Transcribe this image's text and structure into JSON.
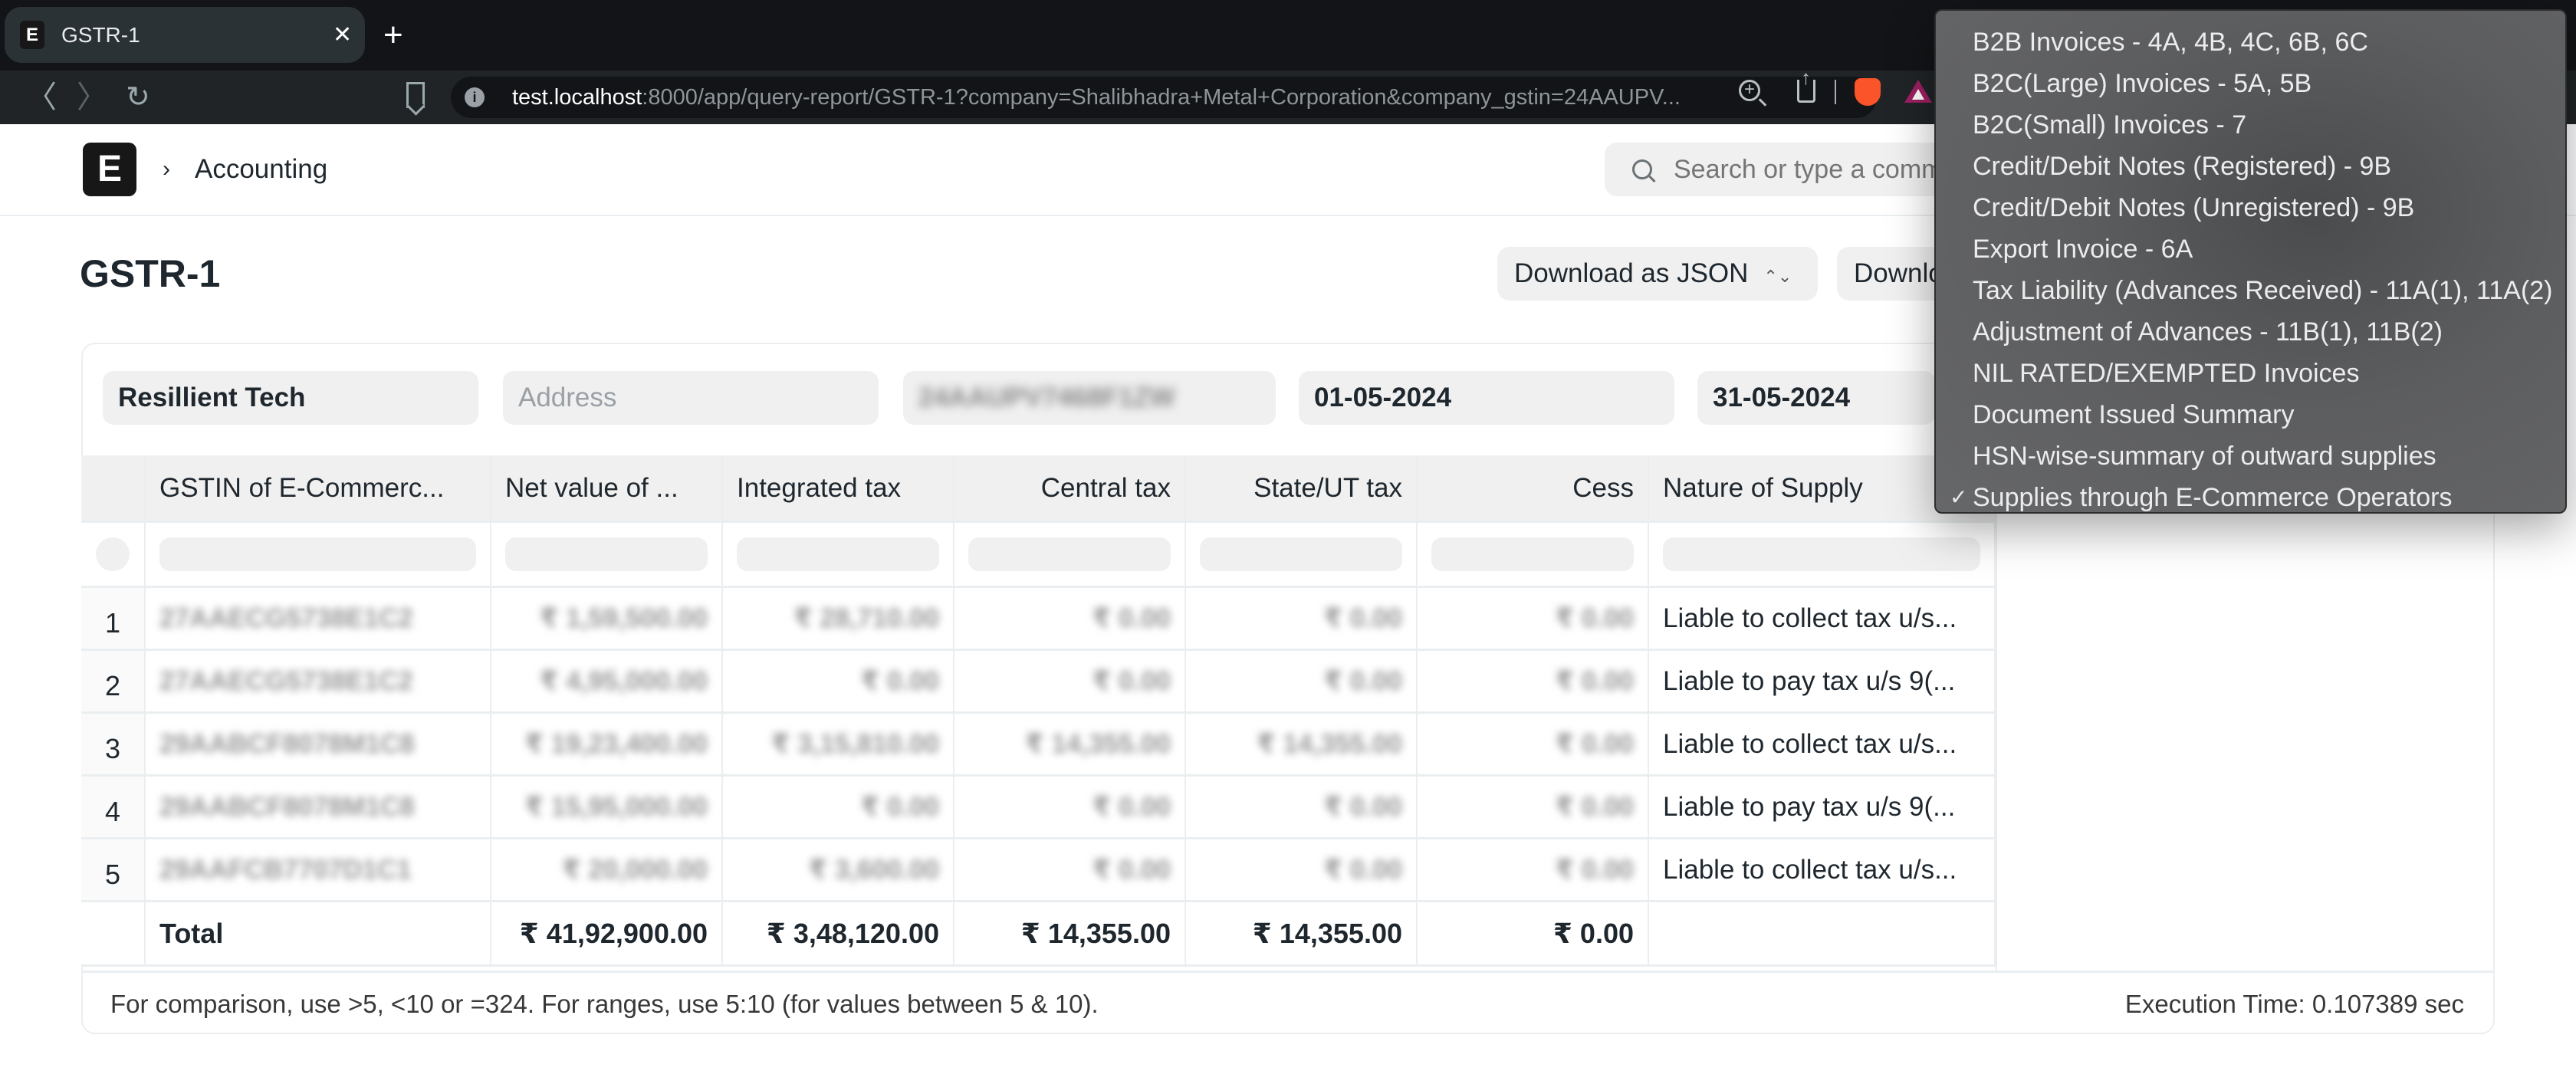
{
  "browser": {
    "tab_title": "GSTR-1",
    "tab_favicon": "E",
    "url_host": "test.localhost",
    "url_rest": ":8000/app/query-report/GSTR-1?company=Shalibhadra+Metal+Corporation&company_gstin=24AAUPV...",
    "close_glyph": "✕",
    "new_tab_glyph": "+",
    "back_glyph": "〈",
    "forward_glyph": "〉",
    "reload_glyph": "↻",
    "info_glyph": "i",
    "zoom_glyph": "+"
  },
  "navbar": {
    "logo": "E",
    "breadcrumb_separator": "›",
    "breadcrumb": "Accounting",
    "search_placeholder": "Search or type a command"
  },
  "page": {
    "title": "GSTR-1",
    "download_json_label": "Download as JSON",
    "download_json_updown": "⌃⌄",
    "download_other_label": "Download"
  },
  "filters": {
    "company": "Resillient Tech",
    "address_placeholder": "Address",
    "company_gstin": "24AAUPV7468F1ZW",
    "from_date": "01-05-2024",
    "to_date": "31-05-2024"
  },
  "table": {
    "columns": [
      "GSTIN of E-Commerc...",
      "Net value of ...",
      "Integrated tax",
      "Central tax",
      "State/UT tax",
      "Cess",
      "Nature of Supply"
    ],
    "rows": [
      {
        "index": "1",
        "gstin": "27AAECG5738E1C2",
        "net_value": "₹ 1,59,500.00",
        "integrated_tax": "₹ 28,710.00",
        "central_tax": "₹ 0.00",
        "state_tax": "₹ 0.00",
        "cess": "₹ 0.00",
        "nature": "Liable to collect tax u/s..."
      },
      {
        "index": "2",
        "gstin": "27AAECG5738E1C2",
        "net_value": "₹ 4,95,000.00",
        "integrated_tax": "₹ 0.00",
        "central_tax": "₹ 0.00",
        "state_tax": "₹ 0.00",
        "cess": "₹ 0.00",
        "nature": "Liable to pay tax u/s 9(..."
      },
      {
        "index": "3",
        "gstin": "29AABCF8078M1C8",
        "net_value": "₹ 19,23,400.00",
        "integrated_tax": "₹ 3,15,810.00",
        "central_tax": "₹ 14,355.00",
        "state_tax": "₹ 14,355.00",
        "cess": "₹ 0.00",
        "nature": "Liable to collect tax u/s..."
      },
      {
        "index": "4",
        "gstin": "29AABCF8078M1C8",
        "net_value": "₹ 15,95,000.00",
        "integrated_tax": "₹ 0.00",
        "central_tax": "₹ 0.00",
        "state_tax": "₹ 0.00",
        "cess": "₹ 0.00",
        "nature": "Liable to pay tax u/s 9(..."
      },
      {
        "index": "5",
        "gstin": "29AAFCB7707D1C1",
        "net_value": "₹ 20,000.00",
        "integrated_tax": "₹ 3,600.00",
        "central_tax": "₹ 0.00",
        "state_tax": "₹ 0.00",
        "cess": "₹ 0.00",
        "nature": "Liable to collect tax u/s..."
      }
    ],
    "total": {
      "label": "Total",
      "net_value": "₹ 41,92,900.00",
      "integrated_tax": "₹ 3,48,120.00",
      "central_tax": "₹ 14,355.00",
      "state_tax": "₹ 14,355.00",
      "cess": "₹ 0.00"
    }
  },
  "footer": {
    "hint": "For comparison, use >5, <10 or =324. For ranges, use 5:10 (for values between 5 & 10).",
    "execution_time": "Execution Time: 0.107389 sec"
  },
  "dropdown": {
    "check_glyph": "✓",
    "selected_index": 11,
    "options": [
      "B2B Invoices - 4A, 4B, 4C, 6B, 6C",
      "B2C(Large) Invoices - 5A, 5B",
      "B2C(Small) Invoices - 7",
      "Credit/Debit Notes (Registered) - 9B",
      "Credit/Debit Notes (Unregistered) - 9B",
      "Export Invoice - 6A",
      "Tax Liability (Advances Received) - 11A(1), 11A(2)",
      "Adjustment of Advances - 11B(1), 11B(2)",
      "NIL RATED/EXEMPTED Invoices",
      "Document Issued Summary",
      "HSN-wise-summary of outward supplies",
      "Supplies through E-Commerce Operators"
    ]
  }
}
